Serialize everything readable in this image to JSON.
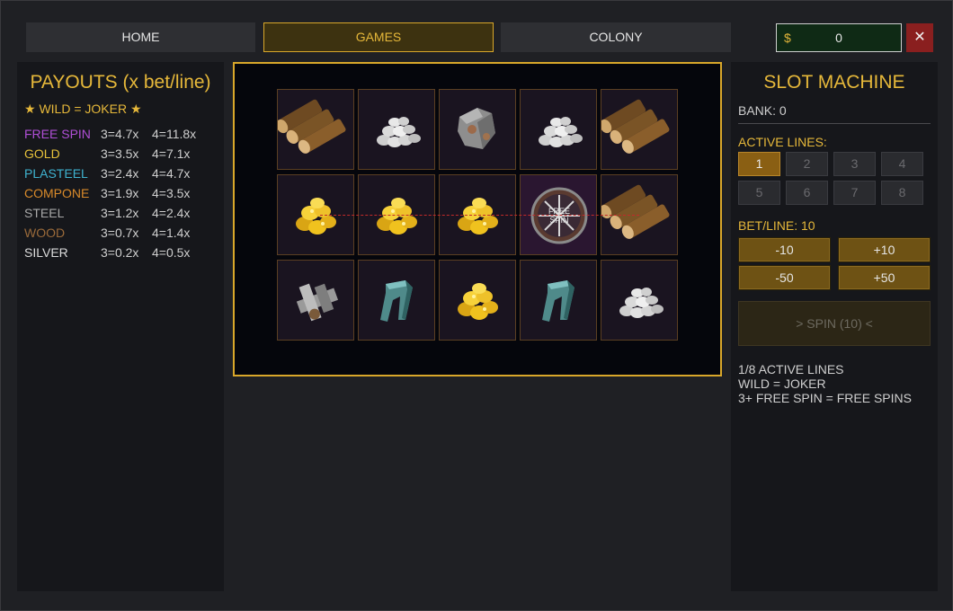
{
  "nav": {
    "home": "HOME",
    "games": "GAMES",
    "colony": "COLONY"
  },
  "money": {
    "symbol": "$",
    "value": "0"
  },
  "close_label": "✕",
  "payouts": {
    "title": "PAYOUTS (x bet/line)",
    "wild_note": "★ WILD = JOKER ★",
    "rows": [
      {
        "name": "FREE SPIN",
        "three": "3=4.7x",
        "four": "4=11.8x",
        "color": "#b04fd6"
      },
      {
        "name": "GOLD",
        "three": "3=3.5x",
        "four": "4=7.1x",
        "color": "#e6c13a"
      },
      {
        "name": "PLASTEEL",
        "three": "3=2.4x",
        "four": "4=4.7x",
        "color": "#3fb3d0"
      },
      {
        "name": "COMPONE",
        "three": "3=1.9x",
        "four": "4=3.5x",
        "color": "#d98a2a"
      },
      {
        "name": "STEEL",
        "three": "3=1.2x",
        "four": "4=2.4x",
        "color": "#a8a8a8"
      },
      {
        "name": "WOOD",
        "three": "3=0.7x",
        "four": "4=1.4x",
        "color": "#9a6a3a"
      },
      {
        "name": "SILVER",
        "three": "3=0.2x",
        "four": "4=0.5x",
        "color": "#dcdcdc"
      }
    ]
  },
  "reels": [
    [
      "wood-icon",
      "silver-icon",
      "steel-icon",
      "silver-icon",
      "wood-icon"
    ],
    [
      "gold-icon",
      "gold-icon",
      "gold-icon",
      "free-spin-icon",
      "wood-icon"
    ],
    [
      "component-icon",
      "plasteel-icon",
      "gold-icon",
      "plasteel-icon",
      "silver-icon"
    ]
  ],
  "free_spin_text": "FREE SPIN",
  "machine": {
    "title": "SLOT MACHINE",
    "bank": "BANK: 0",
    "active_lines_label": "ACTIVE LINES:",
    "lines": [
      "1",
      "2",
      "3",
      "4",
      "5",
      "6",
      "7",
      "8"
    ],
    "active_line": 1,
    "bet_label": "BET/LINE: 10",
    "bet_buttons": [
      "-10",
      "+10",
      "-50",
      "+50"
    ],
    "spin_label": "> SPIN (10) <",
    "info": [
      "1/8 ACTIVE LINES",
      "WILD = JOKER",
      "3+ FREE SPIN = FREE SPINS"
    ]
  }
}
